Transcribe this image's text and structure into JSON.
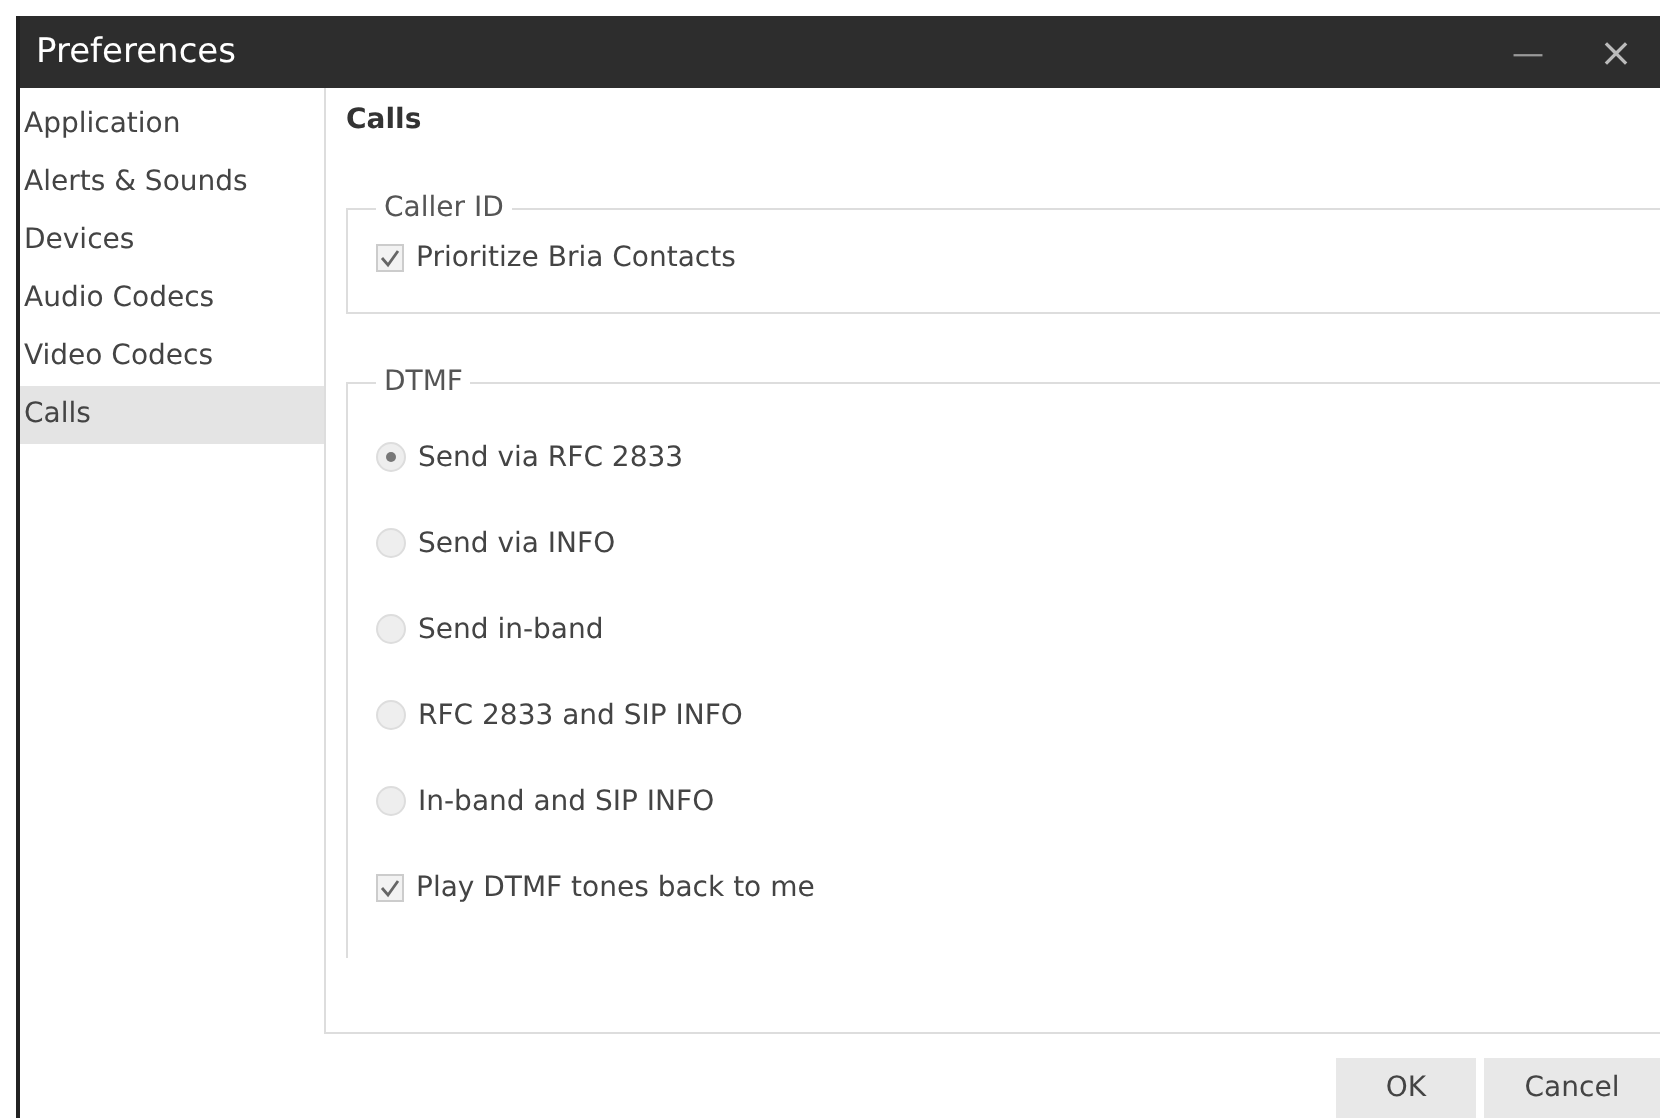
{
  "window": {
    "title": "Preferences",
    "controls": [
      {
        "kind": "minimize",
        "label": "—"
      },
      {
        "kind": "close",
        "label": "×"
      }
    ]
  },
  "sidebar": {
    "items": [
      {
        "label": "Application",
        "selected": false
      },
      {
        "label": "Alerts & Sounds",
        "selected": false
      },
      {
        "label": "Devices",
        "selected": false
      },
      {
        "label": "Audio Codecs",
        "selected": false
      },
      {
        "label": "Video Codecs",
        "selected": false
      },
      {
        "label": "Calls",
        "selected": true
      }
    ]
  },
  "page": {
    "heading": "Calls",
    "groups": [
      {
        "title": "Caller ID",
        "options": [
          {
            "kind": "checkbox",
            "label": "Prioritize Bria Contacts",
            "checked": true
          }
        ]
      },
      {
        "title": "DTMF",
        "options": [
          {
            "kind": "radio",
            "label": "Send via RFC 2833",
            "selected": true
          },
          {
            "kind": "radio",
            "label": "Send via INFO",
            "selected": false
          },
          {
            "kind": "radio",
            "label": "Send in-band",
            "selected": false
          },
          {
            "kind": "radio",
            "label": "RFC 2833 and SIP INFO",
            "selected": false
          },
          {
            "kind": "radio",
            "label": "In-band and SIP INFO",
            "selected": false
          },
          {
            "kind": "checkbox",
            "label": "Play DTMF tones back to me",
            "checked": true
          }
        ]
      }
    ]
  },
  "buttons": [
    "OK",
    "Cancel"
  ]
}
